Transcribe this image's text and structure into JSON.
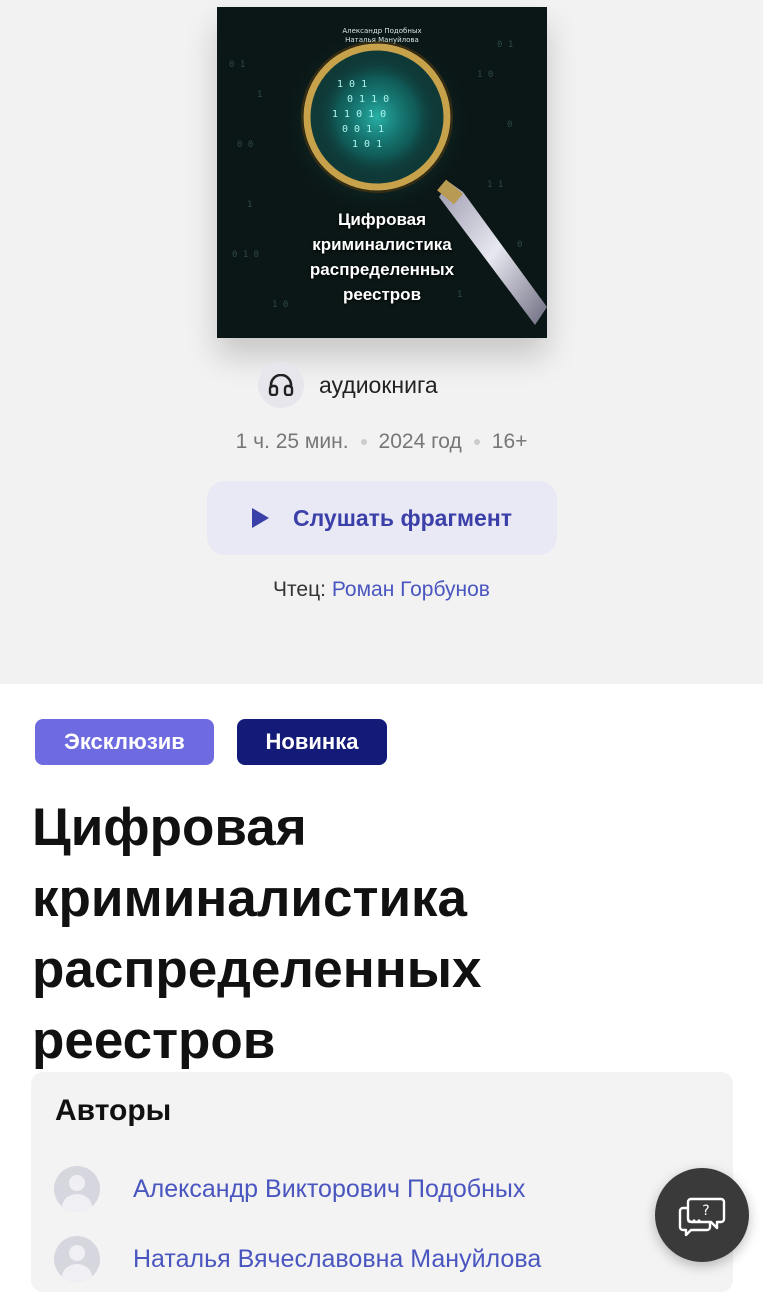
{
  "cover": {
    "authors": [
      "Александр Подобных",
      "Наталья Мануйлова"
    ],
    "title_lines": [
      "Цифровая",
      "криминалистика",
      "распределенных",
      "реестров"
    ]
  },
  "format": {
    "label": "аудиокнига",
    "icon": "headphones-icon"
  },
  "meta": {
    "duration": "1 ч. 25 мин.",
    "year": "2024 год",
    "age": "16+"
  },
  "listen_button": {
    "label": "Слушать фрагмент",
    "icon": "play-icon"
  },
  "reader": {
    "label": "Чтец:",
    "name": "Роман Горбунов"
  },
  "badges": {
    "exclusive": "Эксклюзив",
    "new": "Новинка"
  },
  "title_lines": [
    "Цифровая",
    "криминалистика",
    "распределенных",
    "реестров"
  ],
  "authors": {
    "heading": "Авторы",
    "items": [
      {
        "name": "Александр Викторович Подобных"
      },
      {
        "name": "Наталья Вячеславовна Мануйлова"
      }
    ]
  },
  "help": {
    "icon": "chat-help-icon"
  },
  "colors": {
    "accent": "#3b3fa8",
    "link": "#4a56c0",
    "badge_exclusive": "#6e6ae0",
    "badge_new": "#141a78"
  }
}
